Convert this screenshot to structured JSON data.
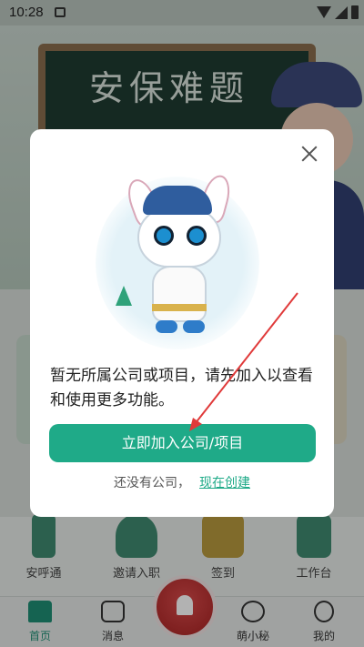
{
  "statusbar": {
    "time": "10:28"
  },
  "banner": {
    "board_text": "安保难题"
  },
  "shortcuts": [
    {
      "label": "安呼通"
    },
    {
      "label": "邀请入职"
    },
    {
      "label": "签到"
    },
    {
      "label": "工作台"
    }
  ],
  "bottomnav": {
    "items": [
      {
        "label": "首页",
        "icon": "home-icon",
        "active": true
      },
      {
        "label": "消息",
        "icon": "message-icon",
        "active": false
      },
      {
        "label": "萌小秘",
        "icon": "assistant-icon",
        "active": false
      },
      {
        "label": "我的",
        "icon": "profile-icon",
        "active": false
      }
    ],
    "center_icon": "alarm-icon"
  },
  "dialog": {
    "message": "暂无所属公司或项目，请先加入以查看和使用更多功能。",
    "primary_button": "立即加入公司/项目",
    "footer_text": "还没有公司，",
    "create_link": "现在创建"
  },
  "colors": {
    "accent": "#1faa88",
    "annotation_arrow": "#e03a3a",
    "alarm": "#c23030"
  }
}
